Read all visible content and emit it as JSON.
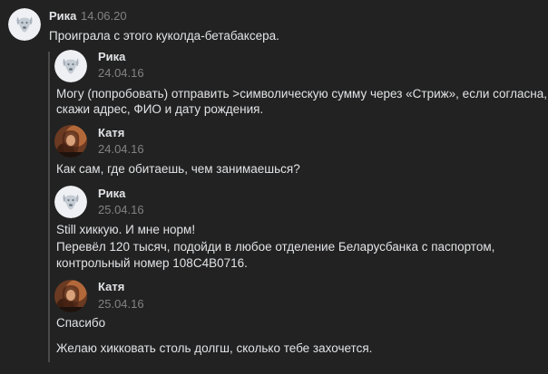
{
  "post": {
    "author": "Рика",
    "date": "14.06.20",
    "text": "Проиграла с этого куколда-бетабаксера."
  },
  "messages": [
    {
      "author": "Рика",
      "date": "24.04.16",
      "avatar": "vk-dog-avatar",
      "lines": [
        "Могу (попробовать) отправить >символическую сумму через «Стриж», если согласна,",
        "скажи адрес, ФИО и дату рождения."
      ]
    },
    {
      "author": "Катя",
      "date": "24.04.16",
      "avatar": "photo-avatar",
      "lines": [
        "Как сам, где обитаешь, чем занимаешься?"
      ]
    },
    {
      "author": "Рика",
      "date": "25.04.16",
      "avatar": "vk-dog-avatar",
      "lines": [
        "Still хиккую. И мне норм!",
        "Перевёл 120 тысяч, подойди в любое отделение Беларусбанка с паспортом,",
        "контрольный номер 108C4B0716."
      ]
    },
    {
      "author": "Катя",
      "date": "25.04.16",
      "avatar": "photo-avatar",
      "lines": [
        "Спасибо",
        "",
        "Желаю хикковать столь долгш, сколько тебе захочется."
      ]
    }
  ],
  "colors": {
    "background": "#222222",
    "text": "#e1e3e6",
    "muted": "#828282",
    "quote_bar": "#4a4a4a"
  }
}
